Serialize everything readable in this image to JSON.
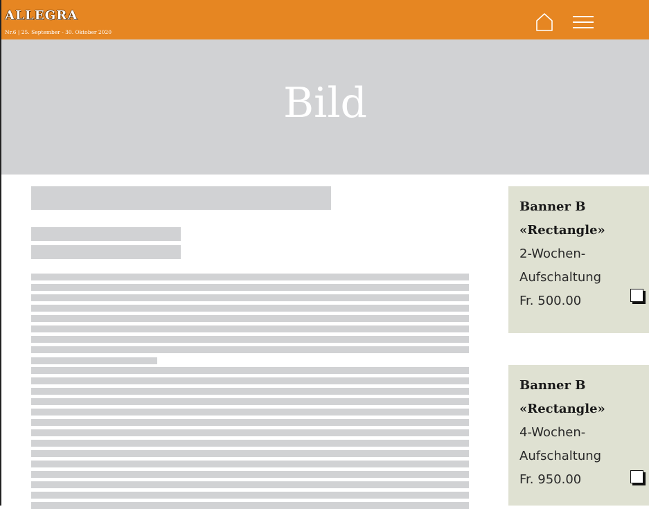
{
  "header": {
    "brand": "ALLEGRA",
    "issue": "Nr.6 | 25. September - 30. Oktober 2020",
    "home_icon": "home-icon",
    "menu_icon": "hamburger-menu-icon",
    "background_color": "#e68622"
  },
  "hero": {
    "label": "Bild",
    "background_color": "#d1d2d4"
  },
  "banners": [
    {
      "title_line1": "Banner B",
      "title_line2": "«Rectangle»",
      "desc_line1": "2-Wochen-",
      "desc_line2": "Aufschaltung",
      "price": "Fr. 500.00",
      "selected": false
    },
    {
      "title_line1": "Banner B",
      "title_line2": "«Rectangle»",
      "desc_line1": "4-Wochen-",
      "desc_line2": "Aufschaltung",
      "price": "Fr. 950.00",
      "selected": false
    }
  ],
  "colors": {
    "card_background": "#dfe1d2",
    "placeholder": "#d1d2d4"
  }
}
